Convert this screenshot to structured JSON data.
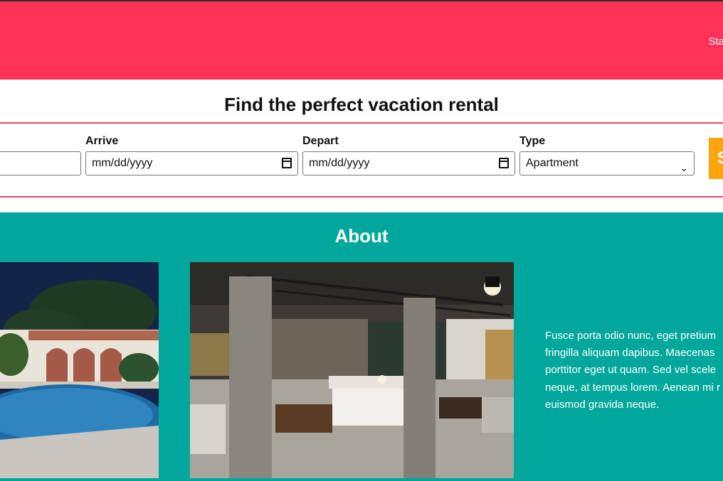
{
  "header": {
    "nav_fragment": "Sta"
  },
  "search": {
    "title": "Find the perfect vacation rental",
    "fields": {
      "arrive": {
        "label": "Arrive",
        "placeholder": "mm/dd/yyyy"
      },
      "depart": {
        "label": "Depart",
        "placeholder": "mm/dd/yyyy"
      },
      "type": {
        "label": "Type",
        "value": "Apartment"
      }
    },
    "button_label": "S"
  },
  "about": {
    "title": "About",
    "text_lines": [
      "Fusce porta odio nunc, eget pretium",
      "fringilla aliquam dapibus. Maecenas",
      "porttitor eget ut quam. Sed vel scele",
      "neque, at tempus lorem. Aenean mi r",
      "euismod gravida neque."
    ]
  },
  "colors": {
    "header_bg": "#ff3358",
    "about_bg": "#02a79b",
    "button_bg": "#ffa40a",
    "rule": "#ee4a6b"
  }
}
